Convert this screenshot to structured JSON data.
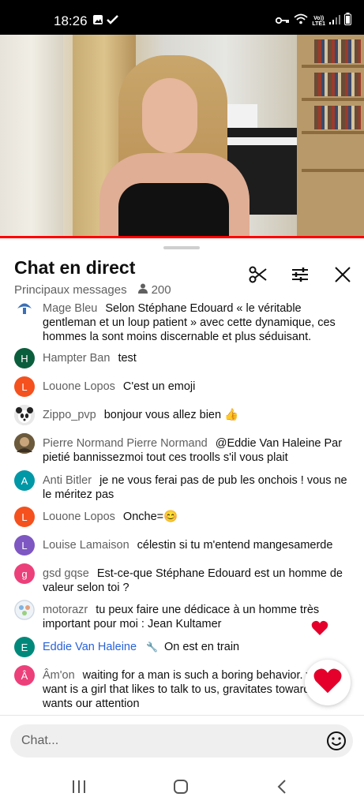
{
  "status_bar": {
    "time": "18:26",
    "network_line1": "Vo))",
    "network_line2": "LTE1"
  },
  "chat_header": {
    "title": "Chat en direct",
    "subtitle": "Principaux messages",
    "viewer_count": "200"
  },
  "messages": [
    {
      "author": "Mage Bleu",
      "text": "Selon Stéphane Edouard « le véritable gentleman et un loup patient » avec cette dynamique, ces hommes la sont moins discernable et plus séduisant.",
      "avatar": "",
      "avatar_color": "#3b6fb6"
    },
    {
      "author": "Hampter Ban",
      "text": "test",
      "avatar": "H",
      "avatar_color": "#0b5e3d"
    },
    {
      "author": "Louone Lopos",
      "text": "C'est un emoji",
      "avatar": "L",
      "avatar_color": "#f4511e"
    },
    {
      "author": "Zippo_pvp",
      "text": "bonjour vous allez bien 👍",
      "avatar": "",
      "avatar_color": "#dddddd"
    },
    {
      "author": "Pierre Normand Pierre Normand",
      "text": "@Eddie Van Haleine Par pietié bannissezmoi tout ces troolls s'il vous plait",
      "avatar": "",
      "avatar_color": "#6b5a3c"
    },
    {
      "author": "Anti Bitler",
      "text": "je ne vous ferai pas de pub les onchois ! vous ne le méritez pas",
      "avatar": "A",
      "avatar_color": "#0097a7"
    },
    {
      "author": "Louone Lopos",
      "text": "Onche=😊",
      "avatar": "L",
      "avatar_color": "#f4511e"
    },
    {
      "author": "Louise Lamaison",
      "text": "célestin si tu m'entend mangesamerde",
      "avatar": "L",
      "avatar_color": "#7e57c2"
    },
    {
      "author": "gsd gqse",
      "text": "Est-ce-que Stéphane Edouard est un homme de valeur selon toi ?",
      "avatar": "g",
      "avatar_color": "#ec407a"
    },
    {
      "author": "motorazr",
      "text": "tu peux faire une dédicace à un homme très important pour moi : Jean Kultamer",
      "avatar": "",
      "avatar_color": "#e8eef5"
    },
    {
      "author": "Eddie Van Haleine",
      "text": "On est en train",
      "avatar": "E",
      "avatar_color": "#00897b"
    },
    {
      "author": "Âm'on",
      "text": "waiting for a man is such a boring behavior. what we want is a girl that likes to talk to us, gravitates towards us, wants our attention",
      "avatar": "Â",
      "avatar_color": "#ec407a"
    }
  ],
  "input": {
    "placeholder": "Chat..."
  },
  "icons": {
    "clip": "scissors-icon",
    "filter": "sliders-icon",
    "close": "close-icon",
    "react": "heart-icon",
    "emoji": "emoji-icon",
    "nav_recent": "recent-apps-icon",
    "nav_home": "home-icon",
    "nav_back": "back-icon"
  },
  "colors": {
    "progress": "#ff0000",
    "heart": "#e4002b",
    "moderator": "#2962d9"
  }
}
